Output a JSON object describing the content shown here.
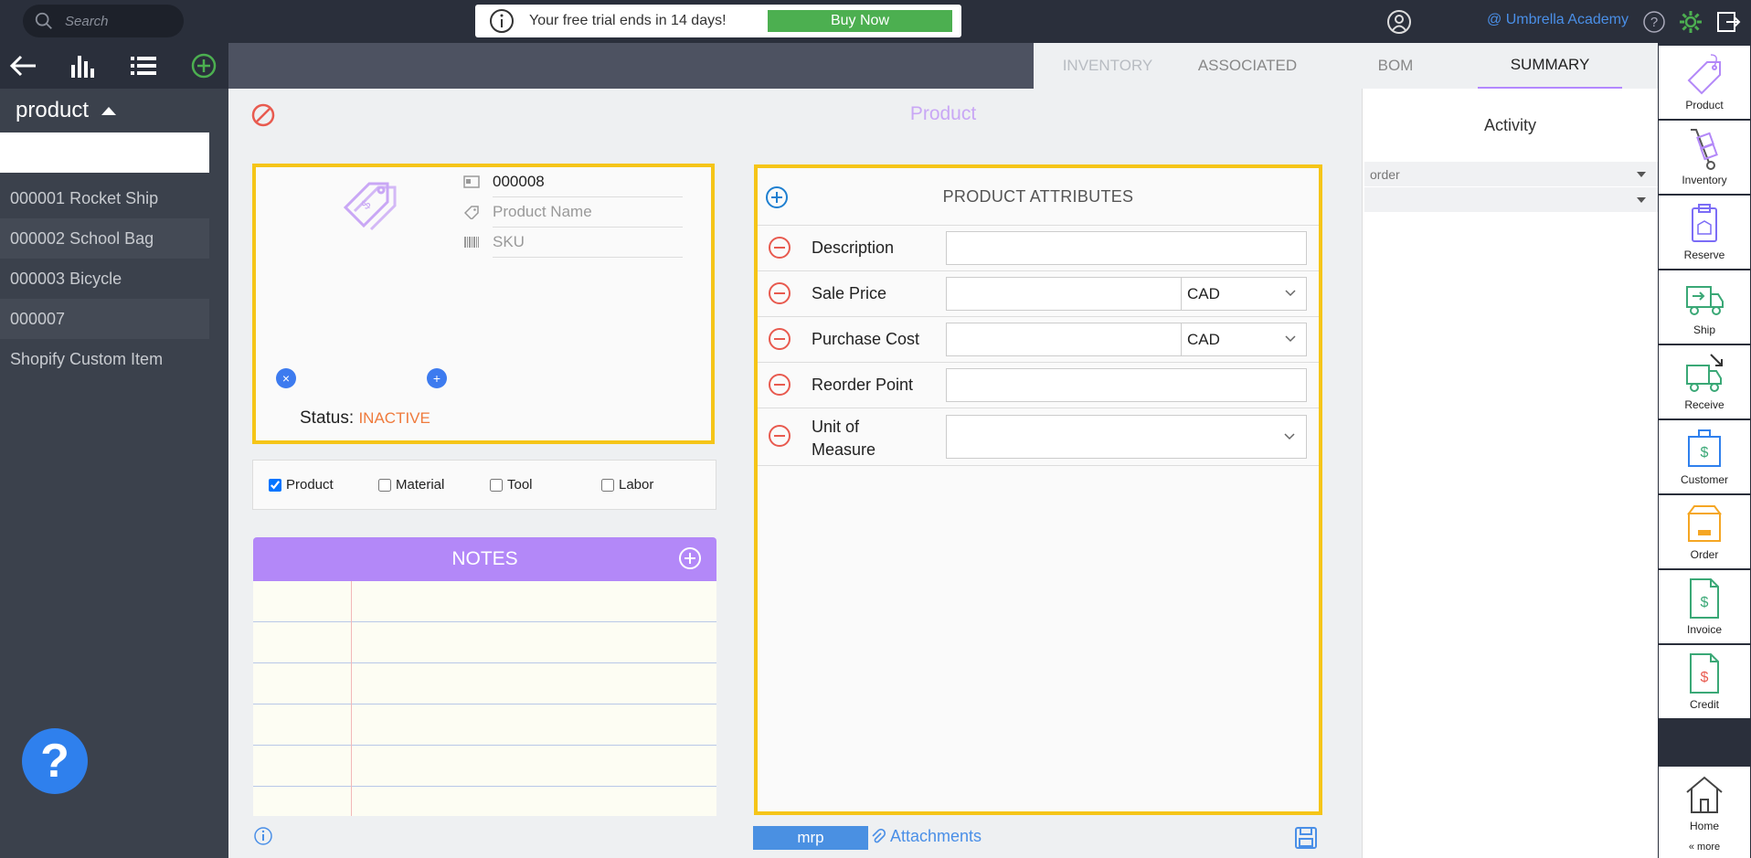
{
  "topbar": {
    "search_placeholder": "Search",
    "trial_message": "Your free trial ends in 14 days!",
    "buy_label": "Buy Now",
    "organization": "@ Umbrella Academy"
  },
  "sidebar": {
    "category": "product",
    "items": [
      {
        "label": "000001 Rocket Ship"
      },
      {
        "label": "000002 School Bag"
      },
      {
        "label": "000003 Bicycle"
      },
      {
        "label": "000007"
      },
      {
        "label": "Shopify Custom Item"
      }
    ],
    "help_label": "?"
  },
  "tabs": [
    {
      "label": "INVENTORY"
    },
    {
      "label": "ASSOCIATED"
    },
    {
      "label": "BOM"
    },
    {
      "label": "SUMMARY",
      "active": true
    }
  ],
  "main": {
    "title": "Product",
    "card": {
      "number": "000008",
      "name_placeholder": "Product Name",
      "sku_placeholder": "SKU",
      "status_label": "Status:",
      "status_value": "INACTIVE"
    },
    "types": [
      {
        "label": "Product",
        "checked": true
      },
      {
        "label": "Material",
        "checked": false
      },
      {
        "label": "Tool",
        "checked": false
      },
      {
        "label": "Labor",
        "checked": false
      }
    ],
    "notes_title": "NOTES"
  },
  "attributes": {
    "title": "PRODUCT ATTRIBUTES",
    "rows": [
      {
        "label": "Description"
      },
      {
        "label": "Sale Price",
        "currency": "CAD"
      },
      {
        "label": "Purchase Cost",
        "currency": "CAD"
      },
      {
        "label": "Reorder Point"
      },
      {
        "label_line1": "Unit of",
        "label_line2": "Measure"
      }
    ]
  },
  "footer": {
    "mrp_label": "mrp",
    "attachments_label": "Attachments"
  },
  "activity": {
    "title": "Activity",
    "filter_value": "order",
    "filter2_value": ""
  },
  "rightnav": [
    {
      "label": "Product"
    },
    {
      "label": "Inventory"
    },
    {
      "label": "Reserve"
    },
    {
      "label": "Ship"
    },
    {
      "label": "Receive"
    },
    {
      "label": "Customer"
    },
    {
      "label": "Order"
    },
    {
      "label": "Invoice"
    },
    {
      "label": "Credit"
    },
    {
      "label": "Home"
    }
  ],
  "more_label": "« more",
  "colors": {
    "accent_purple": "#b388f8",
    "highlight_yellow": "#f5c518",
    "buy_green": "#4caf50",
    "status_orange": "#ef7a3c",
    "link_blue": "#4a8fe7"
  }
}
